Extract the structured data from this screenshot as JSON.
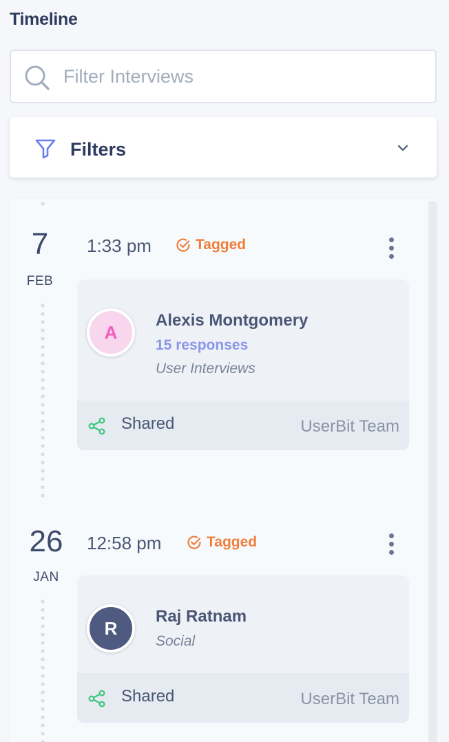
{
  "header": {
    "title": "Timeline"
  },
  "search": {
    "placeholder": "Filter Interviews",
    "value": ""
  },
  "filters": {
    "label": "Filters"
  },
  "entries": [
    {
      "day": "7",
      "month": "FEB",
      "time": "1:33 pm",
      "status": "Tagged",
      "person": {
        "initial": "A",
        "name": "Alexis Montgomery",
        "responses": "15 responses",
        "source": "User Interviews"
      },
      "shared_label": "Shared",
      "team": "UserBit Team"
    },
    {
      "day": "26",
      "month": "JAN",
      "time": "12:58 pm",
      "status": "Tagged",
      "person": {
        "initial": "R",
        "name": "Raj Ratnam",
        "source": "Social"
      },
      "shared_label": "Shared",
      "team": "UserBit Team"
    }
  ],
  "colors": {
    "accent_tagged": "#f07f3c",
    "shared_green": "#3cc77a",
    "avatar_a_bg": "#f7d6ee",
    "avatar_a_text": "#f25cc0",
    "avatar_r_bg": "#4f5a80",
    "responses": "#8a97e8"
  },
  "icons": {
    "search": "search-icon",
    "filter": "filter-icon",
    "chevron": "chevron-down-icon",
    "tagged": "check-circle-icon",
    "more": "more-vertical-icon",
    "share": "share-icon"
  }
}
